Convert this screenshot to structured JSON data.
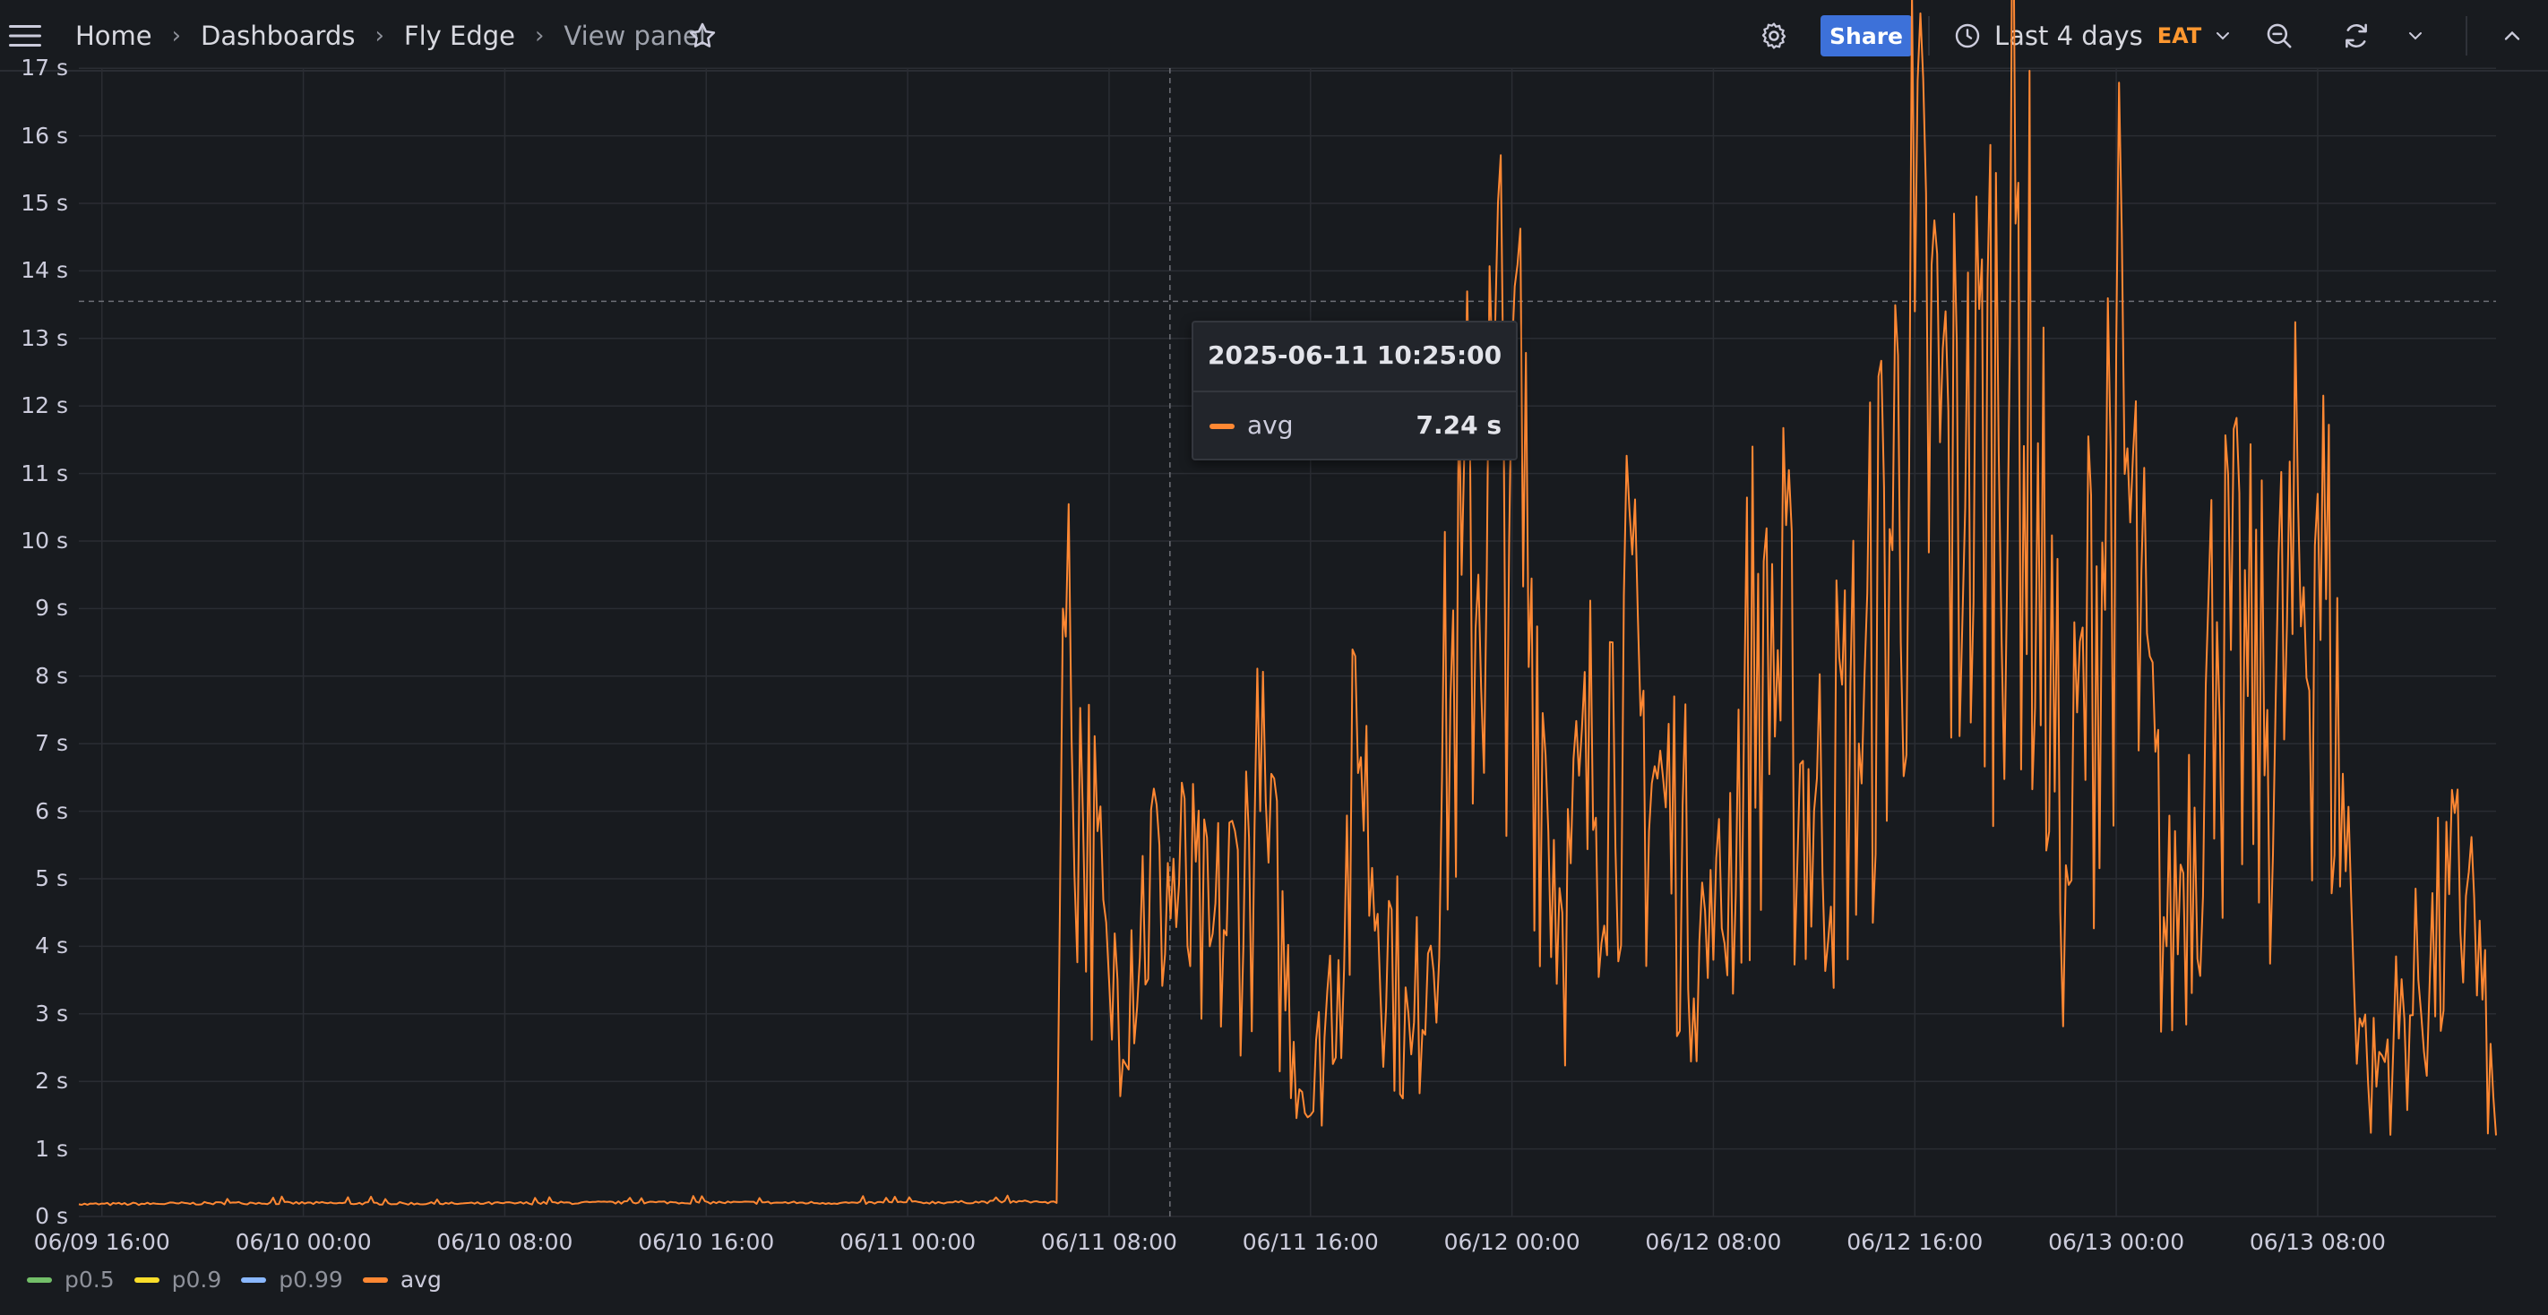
{
  "breadcrumb": {
    "items": [
      "Home",
      "Dashboards",
      "Fly Edge"
    ],
    "current": "View panel"
  },
  "toolbar": {
    "share_label": "Share",
    "time_range": "Last 4 days",
    "timezone": "EAT"
  },
  "colors": {
    "avg": "#ff8833",
    "p05": "#73bf69",
    "p09": "#fade2a",
    "p099": "#8ab8ff",
    "accent": "#3d71d9",
    "timezone": "#ff9830"
  },
  "icons": [
    "menu-icon",
    "star-icon",
    "gear-icon",
    "clock-icon",
    "chevron-down-icon",
    "zoom-out-icon",
    "refresh-icon",
    "chevron-up-icon"
  ],
  "tooltip": {
    "time": "2025-06-11 10:25:00",
    "series": "avg",
    "value": "7.24 s"
  },
  "legend": [
    {
      "name": "p0.5",
      "color": "#73bf69",
      "active": false
    },
    {
      "name": "p0.9",
      "color": "#fade2a",
      "active": false
    },
    {
      "name": "p0.99",
      "color": "#8ab8ff",
      "active": false
    },
    {
      "name": "avg",
      "color": "#ff8833",
      "active": true
    }
  ],
  "chart_data": {
    "type": "line",
    "ylim": [
      0,
      17
    ],
    "yticks": [
      "0 s",
      "1 s",
      "2 s",
      "3 s",
      "4 s",
      "5 s",
      "6 s",
      "7 s",
      "8 s",
      "9 s",
      "10 s",
      "11 s",
      "12 s",
      "13 s",
      "14 s",
      "15 s",
      "16 s",
      "17 s"
    ],
    "xticks": [
      "06/09 16:00",
      "06/10 00:00",
      "06/10 08:00",
      "06/10 16:00",
      "06/11 00:00",
      "06/11 08:00",
      "06/11 16:00",
      "06/12 00:00",
      "06/12 08:00",
      "06/12 16:00",
      "06/13 00:00",
      "06/13 08:00"
    ],
    "x_range": [
      "2025-06-09 15:05",
      "2025-06-13 15:05"
    ],
    "hover_x": "2025-06-11 10:25:00",
    "threshold_line": 13.55,
    "series": [
      {
        "name": "avg",
        "x": [
          "2025-06-09 15:05",
          "2025-06-09 22:00",
          "2025-06-10 06:00",
          "2025-06-10 14:00",
          "2025-06-10 22:00",
          "2025-06-11 05:00",
          "2025-06-11 05:55",
          "2025-06-11 06:10",
          "2025-06-11 08:00",
          "2025-06-11 10:00",
          "2025-06-11 12:00",
          "2025-06-11 14:00",
          "2025-06-11 16:00",
          "2025-06-11 18:00",
          "2025-06-11 20:00",
          "2025-06-11 22:00",
          "2025-06-12 00:00",
          "2025-06-12 02:00",
          "2025-06-12 04:00",
          "2025-06-12 06:00",
          "2025-06-12 08:00",
          "2025-06-12 10:00",
          "2025-06-12 12:00",
          "2025-06-12 14:00",
          "2025-06-12 16:00",
          "2025-06-12 18:00",
          "2025-06-12 20:00",
          "2025-06-12 22:00",
          "2025-06-13 00:00",
          "2025-06-13 02:00",
          "2025-06-13 04:00",
          "2025-06-13 06:00",
          "2025-06-13 08:00",
          "2025-06-13 10:00",
          "2025-06-13 12:00",
          "2025-06-13 14:00",
          "2025-06-13 15:05"
        ],
        "values": [
          0.18,
          0.2,
          0.19,
          0.21,
          0.2,
          0.22,
          0.2,
          9.0,
          3.5,
          5.5,
          4.0,
          6.0,
          1.5,
          6.8,
          2.4,
          9.5,
          12.8,
          4.5,
          8.5,
          6.5,
          3.8,
          9.7,
          6.0,
          8.0,
          13.4,
          10.5,
          14.7,
          5.2,
          12.9,
          4.0,
          8.8,
          7.5,
          10.7,
          2.0,
          3.5,
          5.1,
          1.2
        ]
      }
    ]
  }
}
